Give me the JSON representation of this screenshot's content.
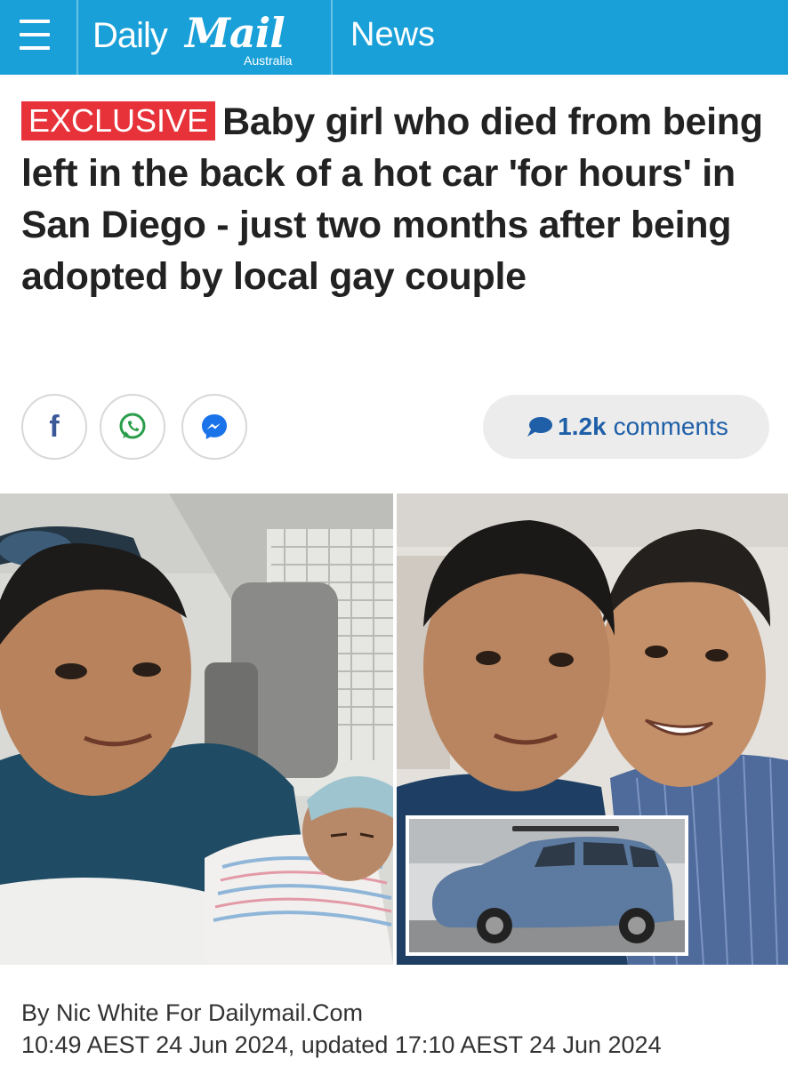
{
  "header": {
    "logo_daily": "Daily",
    "logo_mail": "Mail",
    "logo_region": "Australia",
    "section": "News",
    "bg_color": "#1aa0d8"
  },
  "article": {
    "badge": "EXCLUSIVE",
    "badge_color": "#e8323a",
    "headline": "Baby girl who died from being left in the back of a hot car 'for hours' in San Diego - just two months after being adopted by local gay couple"
  },
  "share": {
    "buttons": [
      {
        "icon": "facebook-icon"
      },
      {
        "icon": "whatsapp-icon"
      },
      {
        "icon": "messenger-icon"
      }
    ],
    "comments_count": "1.2k",
    "comments_label": "comments"
  },
  "byline": {
    "author": "By Nic White For Dailymail.Com",
    "dates": "10:49 AEST 24 Jun 2024, updated 17:10 AEST 24 Jun 2024"
  }
}
